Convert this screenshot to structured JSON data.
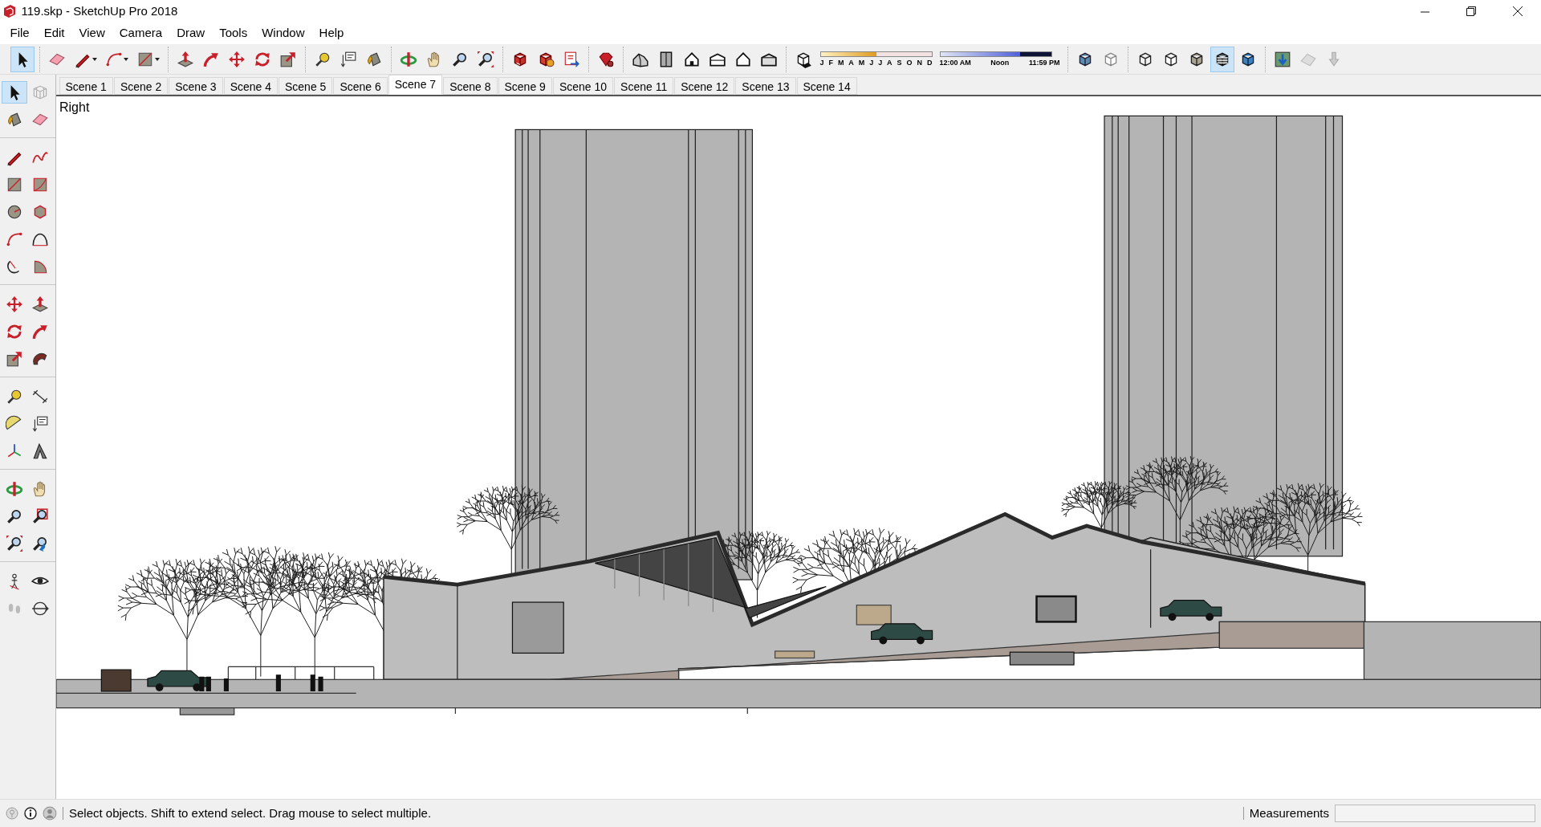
{
  "window": {
    "title": "119.skp - SketchUp Pro 2018"
  },
  "menu": [
    "File",
    "Edit",
    "View",
    "Camera",
    "Draw",
    "Tools",
    "Window",
    "Help"
  ],
  "toolbar": {
    "groups": [
      [
        {
          "selected": true
        }
      ],
      [
        {
          "selected": false
        },
        {
          "selected": false
        },
        {
          "selected": false
        },
        {
          "selected": false
        }
      ],
      [
        {
          "selected": false
        },
        {
          "selected": false
        },
        {
          "selected": false
        },
        {
          "selected": false
        },
        {
          "selected": false
        }
      ],
      [
        {
          "selected": false
        },
        {
          "selected": false
        },
        {
          "selected": false
        }
      ],
      [
        {
          "selected": false
        },
        {
          "selected": false
        },
        {
          "selected": false
        },
        {
          "selected": false
        }
      ],
      [
        {
          "selected": false
        },
        {
          "selected": false
        },
        {
          "selected": false
        }
      ],
      [
        {
          "selected": false
        }
      ],
      [
        {
          "selected": false
        },
        {
          "selected": false
        },
        {
          "selected": false
        },
        {
          "selected": false
        },
        {
          "selected": false
        },
        {
          "selected": false
        }
      ],
      [
        {
          "selected": false
        }
      ],
      [
        {
          "selected": false
        },
        {
          "selected": false
        }
      ],
      [
        {
          "selected": false
        },
        {
          "selected": false
        },
        {
          "selected": false
        },
        {
          "selected": true
        },
        {
          "selected": false
        }
      ],
      [
        {
          "selected": false
        },
        {
          "selected": false
        },
        {
          "selected": false
        }
      ]
    ],
    "month_slider": {
      "labels": [
        "J",
        "F",
        "M",
        "A",
        "M",
        "J",
        "J",
        "A",
        "S",
        "O",
        "N",
        "D"
      ],
      "level": 0.5
    },
    "time_slider": {
      "labels": [
        "12:00 AM",
        "Noon",
        "11:59 PM"
      ],
      "level": 0.72
    }
  },
  "scenes": [
    {
      "label": "Scene 1",
      "selected": false
    },
    {
      "label": "Scene 2",
      "selected": false
    },
    {
      "label": "Scene 3",
      "selected": false
    },
    {
      "label": "Scene 4",
      "selected": false
    },
    {
      "label": "Scene 5",
      "selected": false
    },
    {
      "label": "Scene 6",
      "selected": false
    },
    {
      "label": "Scene 7",
      "selected": true
    },
    {
      "label": "Scene 8",
      "selected": false
    },
    {
      "label": "Scene 9",
      "selected": false
    },
    {
      "label": "Scene 10",
      "selected": false
    },
    {
      "label": "Scene 11",
      "selected": false
    },
    {
      "label": "Scene 12",
      "selected": false
    },
    {
      "label": "Scene 13",
      "selected": false
    },
    {
      "label": "Scene 14",
      "selected": false
    }
  ],
  "tool_palette": {
    "groups": [
      [
        {
          "selected": true
        },
        {
          "selected": false
        },
        {
          "selected": false
        },
        {
          "selected": false
        }
      ],
      [
        {
          "selected": false
        },
        {
          "selected": false
        },
        {
          "selected": false
        },
        {
          "selected": false
        },
        {
          "selected": false
        },
        {
          "selected": false
        },
        {
          "selected": false
        },
        {
          "selected": false
        },
        {
          "selected": false
        },
        {
          "selected": false
        }
      ],
      [
        {
          "selected": false
        },
        {
          "selected": false
        },
        {
          "selected": false
        },
        {
          "selected": false
        },
        {
          "selected": false
        },
        {
          "selected": false
        }
      ],
      [
        {
          "selected": false
        },
        {
          "selected": false
        },
        {
          "selected": false
        },
        {
          "selected": false
        },
        {
          "selected": false
        },
        {
          "selected": false
        }
      ],
      [
        {
          "selected": false
        },
        {
          "selected": false
        },
        {
          "selected": false
        },
        {
          "selected": false
        },
        {
          "selected": false
        },
        {
          "selected": false
        }
      ],
      [
        {
          "selected": false
        },
        {
          "selected": false
        },
        {
          "selected": false
        },
        {
          "selected": false
        }
      ]
    ]
  },
  "viewport": {
    "view_label": "Right"
  },
  "status_bar": {
    "message": "Select objects. Shift to extend select. Drag mouse to select multiple.",
    "measurements_label": "Measurements"
  }
}
